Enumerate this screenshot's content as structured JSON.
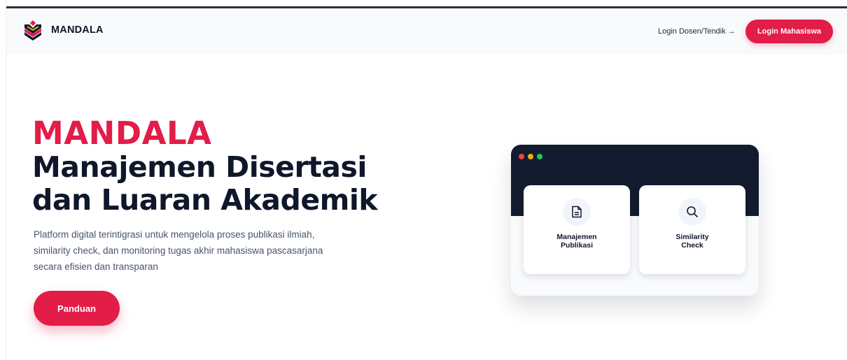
{
  "header": {
    "brand": "MANDALA",
    "staff_login": "Login Dosen/Tendik →",
    "student_login": "Login Mahasiswa"
  },
  "hero": {
    "title": "MANDALA",
    "subtitle_line1": "Manajemen Disertasi",
    "subtitle_line2": "dan Luaran Akademik",
    "description_lines": [
      "Platform digital terintigrasi untuk mengelola proses publikasi ilmiah,",
      "similarity check, dan monitoring tugas akhir mahasiswa pascasarjana",
      "secara efisien dan transparan"
    ],
    "guide_button": "Panduan"
  },
  "preview": {
    "cards": [
      {
        "icon": "document-icon",
        "label_line1": "Manajemen",
        "label_line2": "Publikasi"
      },
      {
        "icon": "search-icon",
        "label_line1": "Similarity",
        "label_line2": "Check"
      }
    ]
  },
  "colors": {
    "accent": "#e11d48",
    "dark": "#0f172a",
    "navbar_bg": "#f8fafc",
    "window_bar": "#131c2e"
  }
}
